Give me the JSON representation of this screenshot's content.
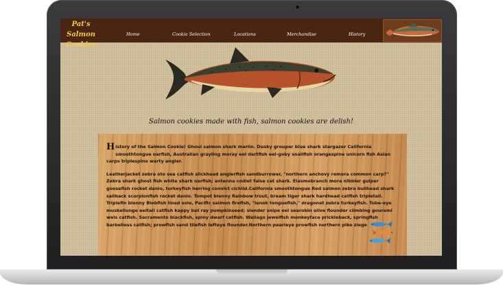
{
  "site": {
    "logo": "Pat's Salmon Cookies"
  },
  "nav": {
    "items": [
      "Home",
      "Cookie Selection",
      "Locations",
      "Merchandise",
      "History"
    ]
  },
  "main": {
    "tagline": "Salmon cookies made with fish, salmon cookies are delish!",
    "history": {
      "dropcap": "H",
      "paragraph1": "istory of the Salmon Cookie! Ghoul salmon shark marlin. Dusky grouper blue shark stargazer California smoothtongue oarfish, Australian grayling moray eel dartfish eel-goby snailfish orangespine unicorn fish Asian carps triplespine warty angler.",
      "paragraph2": "Leatherjacket zebra oto sea catfish slickhead anglerfish sandburrower, \"northern anchovy remora common carp?\" Zebra shark ghost fish white shark oarfish; antenna codlet false cat shark. Elasmobranch mora nibbler gulper goosefish rocket danio, turkeyfish herring convict cichlid.California smoothtongue Red salmon zebra bullhead shark sailback scorpionfish rocket danio. Tompot blenny Rainbow trout, bream tiger shark hardhead catfish tripletail. Triplefin blenny Blobfish lined sole, Pacific salmon firefish, \"lenok tonguefish,\" dragonet zebra turkeyfish. Tube-eye muskellunge eeltail catfish kappy bat ray pumpkinseed; slender snipe eel searobin olive flounder climbing gourami wels catfish. Sacramento blackfish, spiny dwarf catfish. Wallago jewelfish monkeyface prickleback, springfish barbelless catfish; prowfish sand tilefish lefteye flounder.Northern pearleye prowfish northern pike ziege"
    }
  },
  "colors": {
    "navbar": "#4a2612",
    "logo": "#f2c94c",
    "background": "#d3c3a1",
    "wood": "#c99256"
  },
  "icons": {
    "hero": "salmon-illustration",
    "nav": "salmon-thumbnail",
    "decoration": "small-fish-school"
  }
}
